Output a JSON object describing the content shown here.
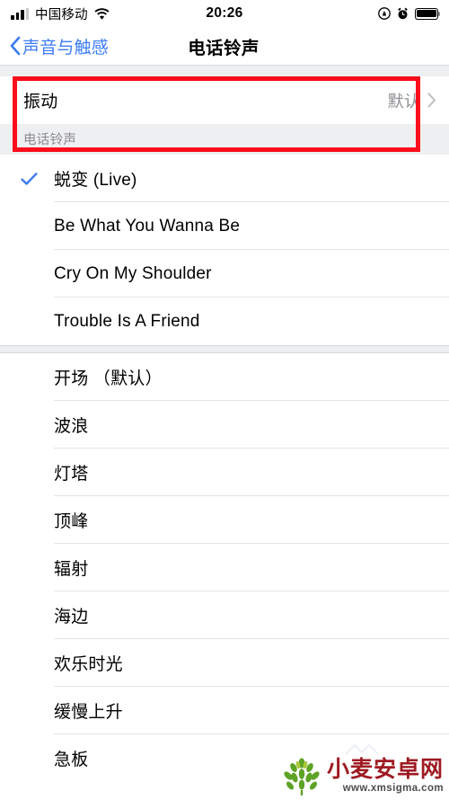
{
  "status_bar": {
    "carrier": "中国移动",
    "time": "20:26",
    "signal_icon": "signal-bars-icon",
    "wifi_icon": "wifi-icon",
    "rotation_lock_icon": "rotation-lock-icon",
    "alarm_icon": "alarm-clock-icon",
    "battery_icon": "battery-full-icon",
    "signal_bars_filled": 3,
    "signal_bars_total": 4,
    "battery_level_percent": 100
  },
  "nav_bar": {
    "back_label": "声音与触感",
    "back_icon": "chevron-left-icon",
    "title": "电话铃声",
    "back_tint_color": "#3c7cf5"
  },
  "vibration": {
    "label": "振动",
    "value": "默认",
    "chevron_icon": "chevron-right-icon"
  },
  "section": {
    "header": "电话铃声"
  },
  "ringtones": {
    "custom": [
      {
        "label": "蜕变 (Live)",
        "selected": true
      },
      {
        "label": "Be What You Wanna Be",
        "selected": false
      },
      {
        "label": "Cry On My Shoulder",
        "selected": false
      },
      {
        "label": "Trouble Is A Friend",
        "selected": false
      }
    ],
    "system": [
      {
        "label": "开场 （默认）",
        "selected": false
      },
      {
        "label": "波浪",
        "selected": false
      },
      {
        "label": "灯塔",
        "selected": false
      },
      {
        "label": "顶峰",
        "selected": false
      },
      {
        "label": "辐射",
        "selected": false
      },
      {
        "label": "海边",
        "selected": false
      },
      {
        "label": "欢乐时光",
        "selected": false
      },
      {
        "label": "缓慢上升",
        "selected": false
      },
      {
        "label": "急板",
        "selected": false
      }
    ],
    "checkmark_icon": "checkmark-icon",
    "checkmark_color": "#3c7cf5"
  },
  "annotation": {
    "shape": "rectangle-highlight",
    "color": "#fb0d1b",
    "targets": "vibration-row"
  },
  "watermark": {
    "title": "小麦安卓网",
    "url": "www.xmsigma.com",
    "logo_icon": "wheat-logo-icon",
    "title_color": "#9e1a22"
  }
}
